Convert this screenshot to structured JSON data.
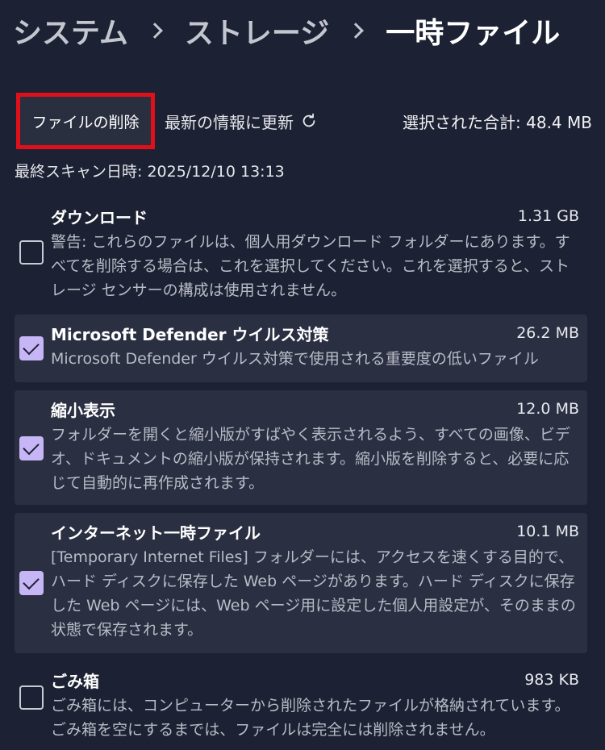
{
  "breadcrumb": {
    "items": [
      "システム",
      "ストレージ",
      "一時ファイル"
    ]
  },
  "toolbar": {
    "delete_label": "ファイルの削除",
    "refresh_label": "最新の情報に更新",
    "refresh_icon": "refresh-icon",
    "total_text": "選択された合計: 48.4 MB"
  },
  "last_scan": "最終スキャン日時: 2025/12/10 13:13",
  "colors": {
    "background": "#1c2133",
    "card": "#2a2f42",
    "checkbox_checked": "#c7b6f5",
    "highlight_border": "#e0101a"
  },
  "items": [
    {
      "title": "ダウンロード",
      "size": "1.31 GB",
      "checked": false,
      "desc": "警告: これらのファイルは、個人用ダウンロード フォルダーにあります。すべてを削除する場合は、これを選択してください。これを選択すると、ストレージ センサーの構成は使用されません。"
    },
    {
      "title": "Microsoft Defender ウイルス対策",
      "size": "26.2 MB",
      "checked": true,
      "desc": "Microsoft Defender ウイルス対策で使用される重要度の低いファイル"
    },
    {
      "title": "縮小表示",
      "size": "12.0 MB",
      "checked": true,
      "desc": "フォルダーを開くと縮小版がすばやく表示されるよう、すべての画像、ビデオ、ドキュメントの縮小版が保持されます。縮小版を削除すると、必要に応じて自動的に再作成されます。"
    },
    {
      "title": "インターネット一時ファイル",
      "size": "10.1 MB",
      "checked": true,
      "desc": "[Temporary Internet Files] フォルダーには、アクセスを速くする目的で、ハード ディスクに保存した Web ページがあります。ハード ディスクに保存した Web ページには、Web ページ用に設定した個人用設定が、そのままの状態で保存されます。"
    },
    {
      "title": "ごみ箱",
      "size": "983 KB",
      "checked": false,
      "desc": "ごみ箱には、コンピューターから削除されたファイルが格納されています。ごみ箱を空にするまでは、ファイルは完全には削除されません。"
    }
  ]
}
